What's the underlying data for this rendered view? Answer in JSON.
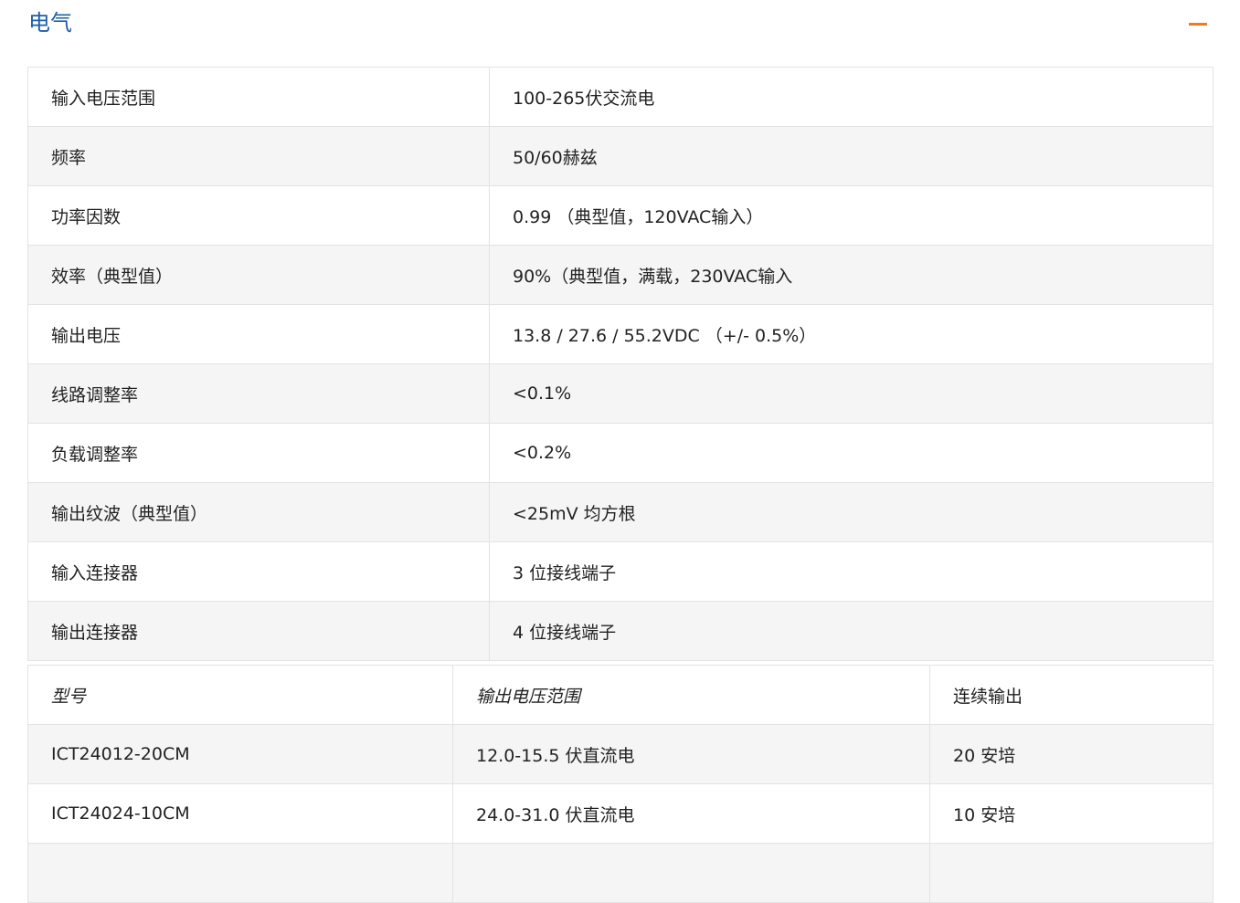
{
  "section": {
    "title": "电气",
    "collapse_icon": "minus-icon",
    "accent_color": "#f07c1b",
    "title_color": "#1e5fa8"
  },
  "specs": [
    {
      "label": "输入电压范围",
      "value": "100-265伏交流电"
    },
    {
      "label": "频率",
      "value": "50/60赫兹"
    },
    {
      "label": "功率因数",
      "value": "0.99 （典型值，120VAC输入）"
    },
    {
      "label": "效率（典型值）",
      "value": "90%（典型值，满载，230VAC输入"
    },
    {
      "label": "输出电压",
      "value": "13.8 / 27.6 / 55.2VDC （+/- 0.5%）"
    },
    {
      "label": "线路调整率",
      "value": "<0.1%"
    },
    {
      "label": "负载调整率",
      "value": "<0.2%"
    },
    {
      "label": "输出纹波（典型值）",
      "value": "<25mV 均方根"
    },
    {
      "label": "输入连接器",
      "value": "3 位接线端子"
    },
    {
      "label": "输出连接器",
      "value": "4 位接线端子"
    }
  ],
  "models": {
    "headers": [
      "型号",
      "输出电压范围",
      "连续输出"
    ],
    "rows": [
      [
        "ICT24012-20CM",
        "12.0-15.5 伏直流电",
        "20 安培"
      ],
      [
        "ICT24024-10CM",
        "24.0-31.0 伏直流电",
        "10 安培"
      ]
    ]
  }
}
